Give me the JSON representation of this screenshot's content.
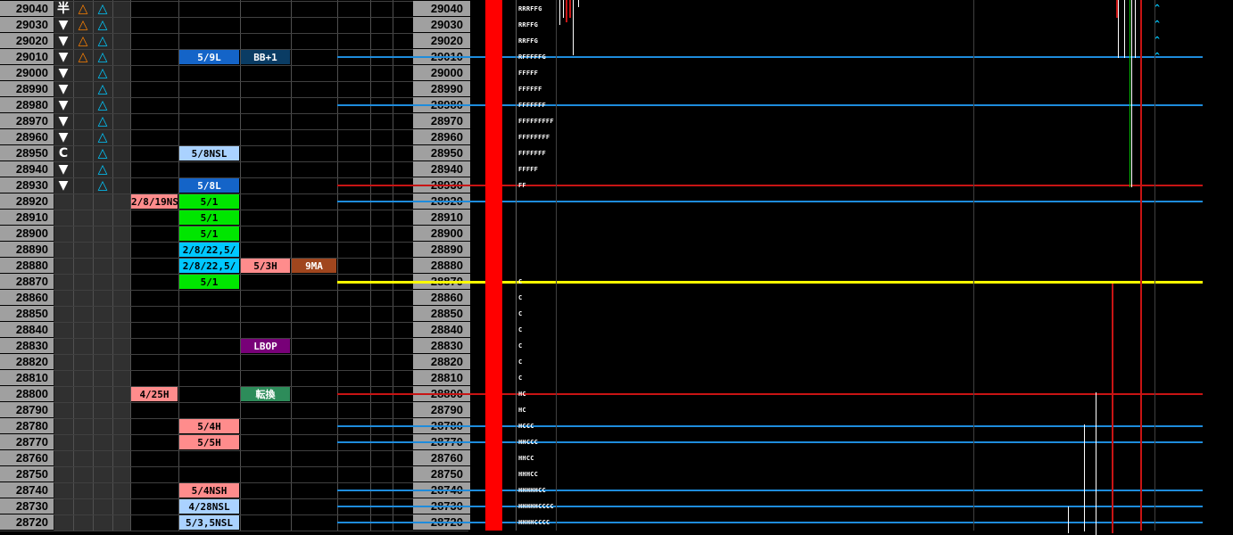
{
  "prices": [
    "29040",
    "29030",
    "29020",
    "29010",
    "29000",
    "28990",
    "28980",
    "28970",
    "28960",
    "28950",
    "28940",
    "28930",
    "28920",
    "28910",
    "28900",
    "28890",
    "28880",
    "28870",
    "28860",
    "28850",
    "28840",
    "28830",
    "28820",
    "28810",
    "28800",
    "28790",
    "28780",
    "28770",
    "28760",
    "28750",
    "28740",
    "28730",
    "28720"
  ],
  "left_markers": [
    {
      "row": 0,
      "col": 0,
      "text": "半",
      "color": "#ffffff"
    },
    {
      "row": 0,
      "col": 1,
      "text": "△",
      "color": "#ff8000"
    },
    {
      "row": 0,
      "col": 2,
      "text": "△",
      "color": "#00c8ff"
    },
    {
      "row": 1,
      "col": 0,
      "text": "▼",
      "color": "#ffffff"
    },
    {
      "row": 1,
      "col": 1,
      "text": "△",
      "color": "#ff8000"
    },
    {
      "row": 1,
      "col": 2,
      "text": "△",
      "color": "#00c8ff"
    },
    {
      "row": 2,
      "col": 0,
      "text": "▼",
      "color": "#ffffff"
    },
    {
      "row": 2,
      "col": 1,
      "text": "△",
      "color": "#ff8000"
    },
    {
      "row": 2,
      "col": 2,
      "text": "△",
      "color": "#00c8ff"
    },
    {
      "row": 3,
      "col": 0,
      "text": "▼",
      "color": "#ffffff"
    },
    {
      "row": 3,
      "col": 1,
      "text": "△",
      "color": "#ff8000"
    },
    {
      "row": 3,
      "col": 2,
      "text": "△",
      "color": "#00c8ff"
    },
    {
      "row": 4,
      "col": 0,
      "text": "▼",
      "color": "#ffffff"
    },
    {
      "row": 4,
      "col": 2,
      "text": "△",
      "color": "#00c8ff"
    },
    {
      "row": 5,
      "col": 0,
      "text": "▼",
      "color": "#ffffff"
    },
    {
      "row": 5,
      "col": 2,
      "text": "△",
      "color": "#00c8ff"
    },
    {
      "row": 6,
      "col": 0,
      "text": "▼",
      "color": "#ffffff"
    },
    {
      "row": 6,
      "col": 2,
      "text": "△",
      "color": "#00c8ff"
    },
    {
      "row": 7,
      "col": 0,
      "text": "▼",
      "color": "#ffffff"
    },
    {
      "row": 7,
      "col": 2,
      "text": "△",
      "color": "#00c8ff"
    },
    {
      "row": 8,
      "col": 0,
      "text": "▼",
      "color": "#ffffff"
    },
    {
      "row": 8,
      "col": 2,
      "text": "△",
      "color": "#00c8ff"
    },
    {
      "row": 9,
      "col": 0,
      "text": "C",
      "color": "#ffffff"
    },
    {
      "row": 9,
      "col": 2,
      "text": "△",
      "color": "#00c8ff"
    },
    {
      "row": 10,
      "col": 0,
      "text": "▼",
      "color": "#ffffff"
    },
    {
      "row": 10,
      "col": 2,
      "text": "△",
      "color": "#00c8ff"
    },
    {
      "row": 11,
      "col": 0,
      "text": "▼",
      "color": "#ffffff"
    },
    {
      "row": 11,
      "col": 2,
      "text": "△",
      "color": "#00c8ff"
    }
  ],
  "tags": [
    {
      "row": 3,
      "col": "c5",
      "text": "5/9L",
      "bg": "#1464c8",
      "fg": "#ffffff"
    },
    {
      "row": 3,
      "col": "c6",
      "text": "BB+1",
      "bg": "#0a3c64",
      "fg": "#ffffff"
    },
    {
      "row": 9,
      "col": "c5",
      "text": "5/8NSL",
      "bg": "#aad2ff",
      "fg": "#000000"
    },
    {
      "row": 11,
      "col": "c5",
      "text": "5/8L",
      "bg": "#1464c8",
      "fg": "#ffffff"
    },
    {
      "row": 12,
      "col": "c4",
      "text": "2/8/19NS",
      "bg": "#ff8c8c",
      "fg": "#000000"
    },
    {
      "row": 12,
      "col": "c5",
      "text": "5/1",
      "bg": "#00e600",
      "fg": "#000000"
    },
    {
      "row": 13,
      "col": "c5",
      "text": "5/1",
      "bg": "#00e600",
      "fg": "#000000"
    },
    {
      "row": 14,
      "col": "c5",
      "text": "5/1",
      "bg": "#00e600",
      "fg": "#000000"
    },
    {
      "row": 15,
      "col": "c5",
      "text": "2/8/22,5/",
      "bg": "#00c8ff",
      "fg": "#000000"
    },
    {
      "row": 16,
      "col": "c5",
      "text": "2/8/22,5/",
      "bg": "#00c8ff",
      "fg": "#000000"
    },
    {
      "row": 16,
      "col": "c6",
      "text": "5/3H",
      "bg": "#ff8c8c",
      "fg": "#000000"
    },
    {
      "row": 16,
      "col": "c7",
      "text": "9MA",
      "bg": "#a0461e",
      "fg": "#ffffff"
    },
    {
      "row": 17,
      "col": "c5",
      "text": "5/1",
      "bg": "#00e600",
      "fg": "#000000"
    },
    {
      "row": 21,
      "col": "c6",
      "text": "LBOP",
      "bg": "#780078",
      "fg": "#ffffff"
    },
    {
      "row": 24,
      "col": "c4",
      "text": "4/25H",
      "bg": "#ff8c8c",
      "fg": "#000000"
    },
    {
      "row": 24,
      "col": "c6",
      "text": "転換",
      "bg": "#2d8c5a",
      "fg": "#ffffff"
    },
    {
      "row": 26,
      "col": "c5",
      "text": "5/4H",
      "bg": "#ff8c8c",
      "fg": "#000000"
    },
    {
      "row": 27,
      "col": "c5",
      "text": "5/5H",
      "bg": "#ff8c8c",
      "fg": "#000000"
    },
    {
      "row": 30,
      "col": "c5",
      "text": "5/4NSH",
      "bg": "#ff8c8c",
      "fg": "#000000"
    },
    {
      "row": 31,
      "col": "c5",
      "text": "4/28NSL",
      "bg": "#aad2ff",
      "fg": "#000000"
    },
    {
      "row": 32,
      "col": "c5",
      "text": "5/3,5NSL",
      "bg": "#aad2ff",
      "fg": "#000000"
    }
  ],
  "tpo": [
    {
      "row": 0,
      "text": "RRRFFG"
    },
    {
      "row": 1,
      "text": "RRFFG"
    },
    {
      "row": 2,
      "text": "RRFFG"
    },
    {
      "row": 3,
      "text": "RFFFFFG"
    },
    {
      "row": 4,
      "text": "FFFFF"
    },
    {
      "row": 5,
      "text": "FFFFFF"
    },
    {
      "row": 6,
      "text": "FFFFFFF"
    },
    {
      "row": 7,
      "text": "FFFFFFFFF"
    },
    {
      "row": 8,
      "text": "FFFFFFFF"
    },
    {
      "row": 9,
      "text": "FFFFFFF"
    },
    {
      "row": 10,
      "text": "FFFFF"
    },
    {
      "row": 11,
      "text": "FF"
    },
    {
      "row": 17,
      "text": "C"
    },
    {
      "row": 18,
      "text": "C"
    },
    {
      "row": 19,
      "text": "C"
    },
    {
      "row": 20,
      "text": "C"
    },
    {
      "row": 21,
      "text": "C"
    },
    {
      "row": 22,
      "text": "C"
    },
    {
      "row": 23,
      "text": "C"
    },
    {
      "row": 24,
      "text": "HC"
    },
    {
      "row": 25,
      "text": "HC"
    },
    {
      "row": 26,
      "text": "HCCC"
    },
    {
      "row": 27,
      "text": "HHCCC"
    },
    {
      "row": 28,
      "text": "HHCC"
    },
    {
      "row": 29,
      "text": "HHHCC"
    },
    {
      "row": 30,
      "text": "HHHHHCC"
    },
    {
      "row": 31,
      "text": "HHHHHCCCC"
    },
    {
      "row": 32,
      "text": "HHHHCCCC"
    }
  ],
  "arrows": [
    {
      "row": 0,
      "text": "^"
    },
    {
      "row": 1,
      "text": "^"
    },
    {
      "row": 2,
      "text": "^"
    },
    {
      "row": 3,
      "text": "^"
    }
  ],
  "hlines": [
    {
      "row": 3,
      "color": "#1e8cdc"
    },
    {
      "row": 6,
      "color": "#1e8cdc"
    },
    {
      "row": 11,
      "color": "#c81414"
    },
    {
      "row": 12,
      "color": "#1e8cdc"
    },
    {
      "row": 17,
      "color": "#ffff00"
    },
    {
      "row": 24,
      "color": "#c81414"
    },
    {
      "row": 26,
      "color": "#1e8cdc"
    },
    {
      "row": 27,
      "color": "#1e8cdc"
    },
    {
      "row": 30,
      "color": "#1e8cdc"
    },
    {
      "row": 31,
      "color": "#1e8cdc"
    },
    {
      "row": 32,
      "color": "#1e8cdc"
    }
  ],
  "colors": {
    "price_bg": "#a0a0a0",
    "red_bar": "#ff0000",
    "grid": "#505050",
    "tpo_arrow": "#00c8ff"
  }
}
